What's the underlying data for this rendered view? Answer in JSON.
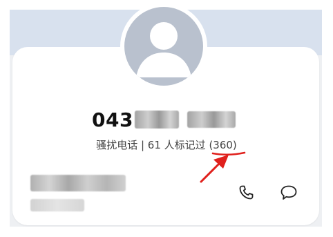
{
  "contact": {
    "phone_prefix": "043",
    "tag_text": "骚扰电话 | 61 人标记过 ",
    "tag_count": "(360)"
  },
  "actions": {
    "call_icon": "phone-icon",
    "message_icon": "message-bubble-icon"
  },
  "colors": {
    "top_band": "#d8e1ee",
    "avatar_fill": "#b9c1ce",
    "annotation_red": "#e0201c"
  }
}
